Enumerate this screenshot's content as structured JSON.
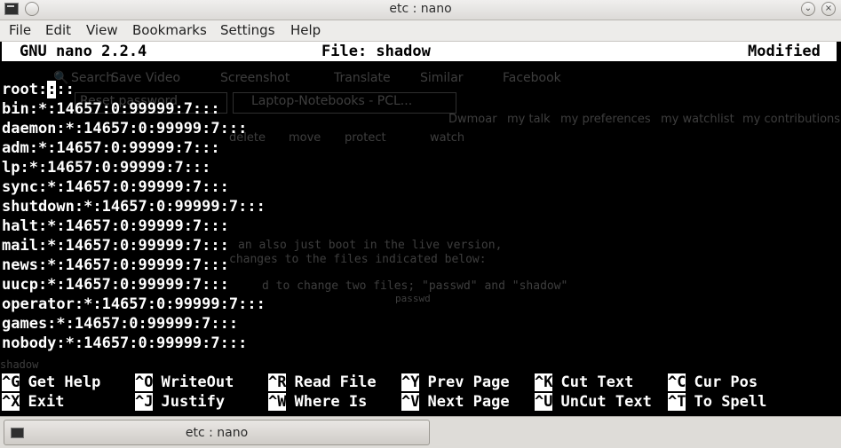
{
  "window": {
    "title": "etc : nano",
    "buttons": {
      "minimize": "⌄",
      "close": "×"
    }
  },
  "menubar": {
    "items": [
      "File",
      "Edit",
      "View",
      "Bookmarks",
      "Settings",
      "Help"
    ]
  },
  "nano": {
    "version": "GNU nano 2.2.4",
    "file": "File: shadow",
    "status": "Modified",
    "lines": [
      "root:",
      "bin:*:14657:0:99999:7:::",
      "daemon:*:14657:0:99999:7:::",
      "adm:*:14657:0:99999:7:::",
      "lp:*:14657:0:99999:7:::",
      "sync:*:14657:0:99999:7:::",
      "shutdown:*:14657:0:99999:7:::",
      "halt:*:14657:0:99999:7:::",
      "mail:*:14657:0:99999:7:::",
      "news:*:14657:0:99999:7:::",
      "uucp:*:14657:0:99999:7:::",
      "operator:*:14657:0:99999:7:::",
      "games:*:14657:0:99999:7:::",
      "nobody:*:14657:0:99999:7:::"
    ],
    "first_line": {
      "before": "root:",
      "cursor": ":",
      "after": "::"
    },
    "shortcuts": [
      [
        {
          "key": "^G",
          "label": "Get Help"
        },
        {
          "key": "^O",
          "label": "WriteOut"
        },
        {
          "key": "^R",
          "label": "Read File"
        },
        {
          "key": "^Y",
          "label": "Prev Page"
        },
        {
          "key": "^K",
          "label": "Cut Text"
        },
        {
          "key": "^C",
          "label": "Cur Pos"
        }
      ],
      [
        {
          "key": "^X",
          "label": "Exit"
        },
        {
          "key": "^J",
          "label": "Justify"
        },
        {
          "key": "^W",
          "label": "Where Is"
        },
        {
          "key": "^V",
          "label": "Next Page"
        },
        {
          "key": "^U",
          "label": "UnCut Text"
        },
        {
          "key": "^T",
          "label": "To Spell"
        }
      ]
    ]
  },
  "background_page": {
    "toolbar": [
      "Search",
      "Save Video",
      "Screenshot",
      "Translate",
      "Similar",
      "Facebook"
    ],
    "tabs": [
      "Reset password",
      "Laptop-Notebooks - PCL..."
    ],
    "user_links": [
      "Dwmoar",
      "my talk",
      "my preferences",
      "my watchlist",
      "my contributions"
    ],
    "page_actions": [
      "delete",
      "move",
      "protect",
      "watch"
    ],
    "body_fragments": [
      "an also just boot in the live version,",
      "changes to the files indicated below:",
      "d to change two files; \"passwd\" and \"shadow\"",
      "passwd",
      "shadow"
    ]
  },
  "taskbar": {
    "task_label": "etc : nano"
  },
  "colors": {
    "terminal_bg": "#000000",
    "terminal_fg": "#ffffff",
    "header_bg": "#ffffff"
  }
}
